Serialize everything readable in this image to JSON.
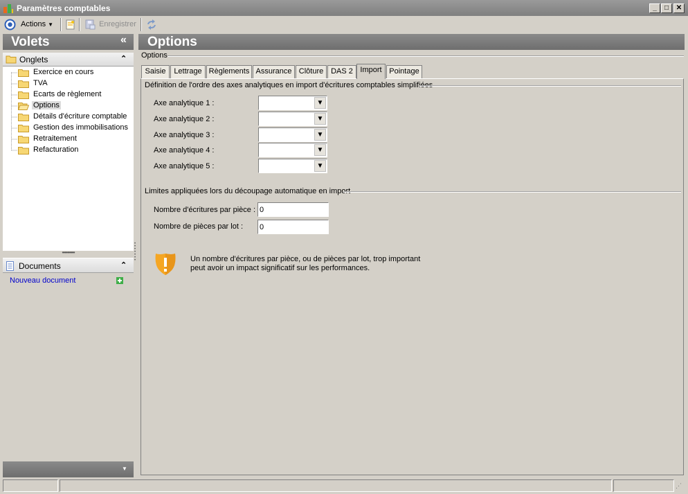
{
  "window": {
    "title": "Paramètres comptables",
    "buttons": {
      "minimize": "_",
      "maximize": "□",
      "close": "✕"
    }
  },
  "toolbar": {
    "actions_label": "Actions",
    "save_label": "Enregistrer"
  },
  "left": {
    "title": "Volets",
    "collapse_glyph": "«",
    "tabs_section": {
      "title": "Onglets",
      "items": [
        {
          "label": "Exercice en cours"
        },
        {
          "label": "TVA"
        },
        {
          "label": "Ecarts de règlement"
        },
        {
          "label": "Options"
        },
        {
          "label": "Détails d'écriture comptable"
        },
        {
          "label": "Gestion des immobilisations"
        },
        {
          "label": "Retraitement"
        },
        {
          "label": "Refacturation"
        }
      ],
      "selected_index": 3
    },
    "documents_section": {
      "title": "Documents",
      "new_document": "Nouveau document"
    }
  },
  "main": {
    "title": "Options",
    "subtitle": "Options",
    "tabs": [
      {
        "label": "Saisie"
      },
      {
        "label": "Lettrage"
      },
      {
        "label": "Règlements"
      },
      {
        "label": "Assurance"
      },
      {
        "label": "Clôture"
      },
      {
        "label": "DAS 2"
      },
      {
        "label": "Import"
      },
      {
        "label": "Pointage"
      }
    ],
    "active_tab_index": 6,
    "group1": {
      "title": "Définition de l'ordre des axes analytiques en import d'écritures comptables simplifiées",
      "fields": [
        {
          "label": "Axe analytique 1 :",
          "value": ""
        },
        {
          "label": "Axe analytique 2 :",
          "value": ""
        },
        {
          "label": "Axe analytique 3 :",
          "value": ""
        },
        {
          "label": "Axe analytique 4 :",
          "value": ""
        },
        {
          "label": "Axe analytique 5 :",
          "value": ""
        }
      ]
    },
    "group2": {
      "title": "Limites appliquées lors du découpage automatique en import",
      "fields": [
        {
          "label": "Nombre d'écritures par pièce :",
          "value": "0"
        },
        {
          "label": "Nombre de pièces par lot :",
          "value": "0"
        }
      ]
    },
    "warning": {
      "line1": "Un nombre d'écritures par pièce, ou de pièces par lot, trop important",
      "line2": "peut avoir un impact significatif sur les performances."
    }
  },
  "colors": {
    "link": "#0000cc",
    "warning_icon": "#f5a623",
    "panel_header": "#7a7a7a"
  }
}
